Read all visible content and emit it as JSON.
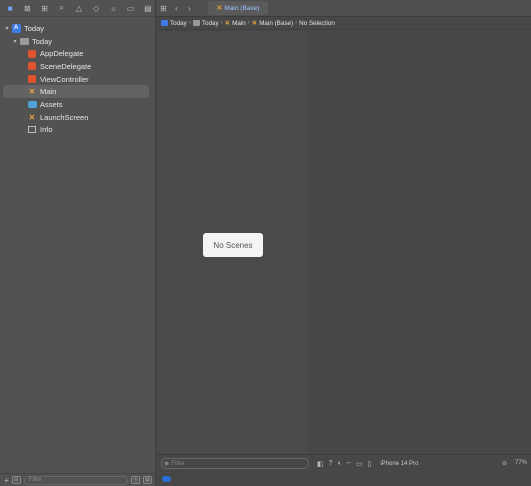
{
  "navigator": {
    "toolbar_icons": [
      "folder-icon",
      "source-control-icon",
      "symbol-icon",
      "find-icon",
      "issue-icon",
      "test-icon",
      "debug-icon",
      "breakpoint-icon",
      "report-icon"
    ],
    "items": [
      {
        "label": "Today",
        "icon": "project-icon",
        "level": 0,
        "disclosure": "▾"
      },
      {
        "label": "Today",
        "icon": "folder-icon",
        "level": 1,
        "disclosure": "▾"
      },
      {
        "label": "AppDelegate",
        "icon": "swift-file-icon",
        "level": 2
      },
      {
        "label": "SceneDelegate",
        "icon": "swift-file-icon",
        "level": 2
      },
      {
        "label": "ViewController",
        "icon": "swift-file-icon",
        "level": 2
      },
      {
        "label": "Main",
        "icon": "storyboard-icon",
        "level": 2,
        "selected": true
      },
      {
        "label": "Assets",
        "icon": "assets-icon",
        "level": 2
      },
      {
        "label": "LaunchScreen",
        "icon": "storyboard-icon",
        "level": 2
      },
      {
        "label": "Info",
        "icon": "plist-icon",
        "level": 2
      }
    ],
    "filter_placeholder": "Filter"
  },
  "editor": {
    "tab_label": "Main (Base)",
    "jumpbar": [
      "Today",
      "Today",
      "Main",
      "Main (Base)",
      "No Selection"
    ],
    "empty_label": "No Scenes",
    "outline_filter_placeholder": "Filter",
    "device": "iPhone 14 Pro",
    "zoom": "77%"
  },
  "colors": {
    "accent": "#3f7be8",
    "swift": "#e0532f",
    "storyboard": "#e8a33a"
  }
}
